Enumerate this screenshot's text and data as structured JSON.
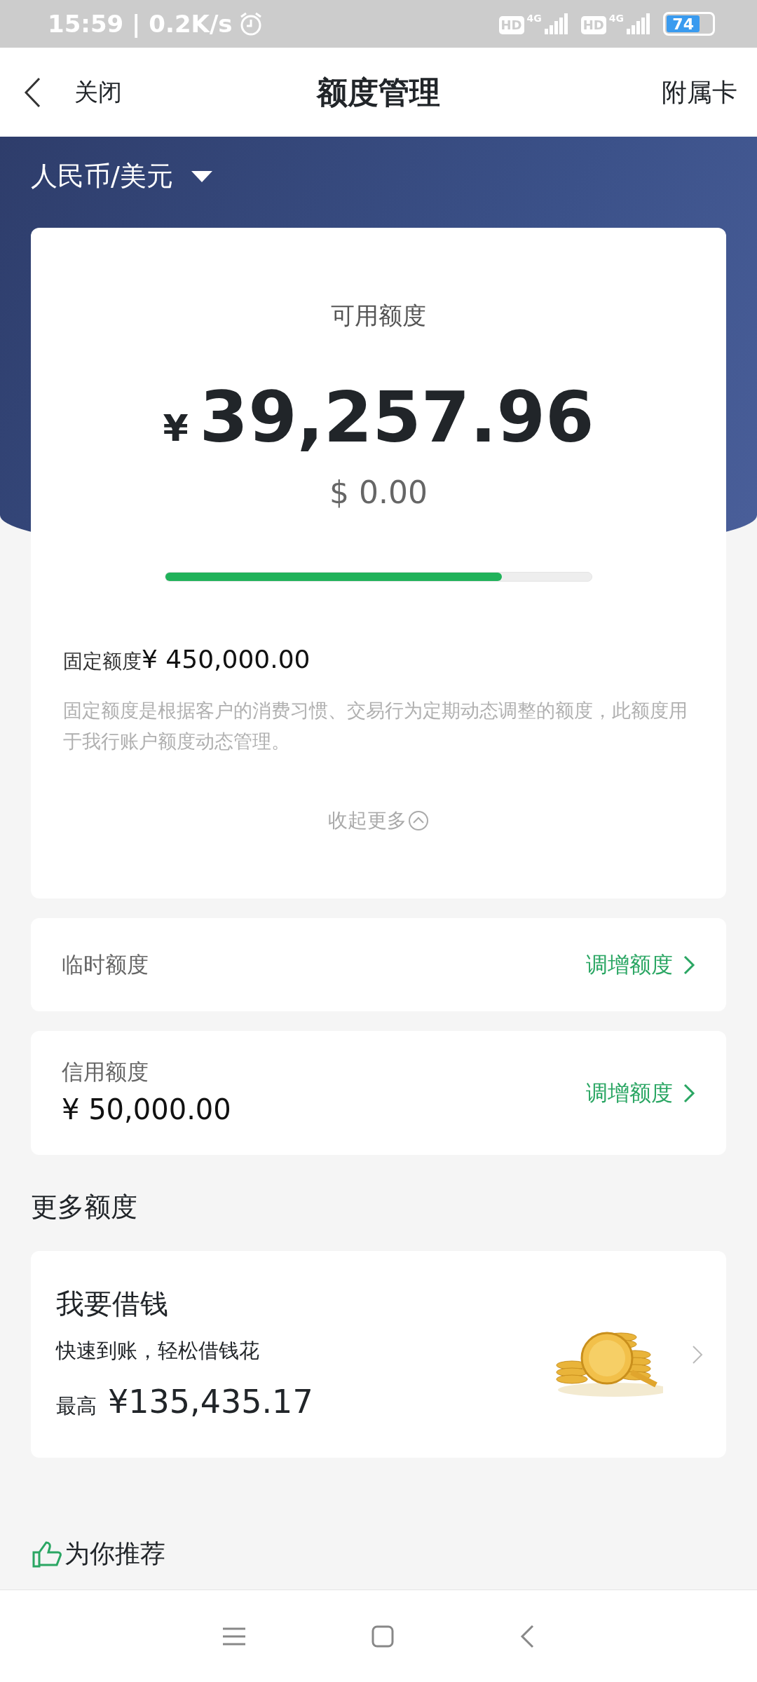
{
  "status_bar": {
    "time": "15:59 | 0.2K/s",
    "signals": [
      {
        "badge": "HD",
        "network": "4G"
      },
      {
        "badge": "HD",
        "network": "4G"
      }
    ],
    "battery": "74"
  },
  "header": {
    "close_label": "关闭",
    "title": "额度管理",
    "right_action": "附属卡"
  },
  "currency_selector": {
    "label": "人民币/美元"
  },
  "available_card": {
    "title": "可用额度",
    "currency_symbol": "¥",
    "amount": "39,257.96",
    "secondary_amount": "$ 0.00",
    "usage": {
      "level": 0.79
    },
    "fixed_label": "固定额度",
    "fixed_value": "¥ 450,000.00",
    "description": "固定额度是根据客户的消费习惯、交易行为定期动态调整的额度，此额度用于我行账户额度动态管理。",
    "collapse_label": "收起更多"
  },
  "limit_rows": [
    {
      "label": "临时额度",
      "action": "调增额度"
    },
    {
      "label": "信用额度",
      "value": "¥ 50,000.00",
      "action": "调增额度"
    }
  ],
  "more_section": {
    "title": "更多额度",
    "loan_card": {
      "title": "我要借钱",
      "subtitle": "快速到账，轻松借钱花",
      "max_label": "最高",
      "max_amount": "¥135,435.17"
    }
  },
  "recommend": {
    "title": "为你推荐"
  }
}
